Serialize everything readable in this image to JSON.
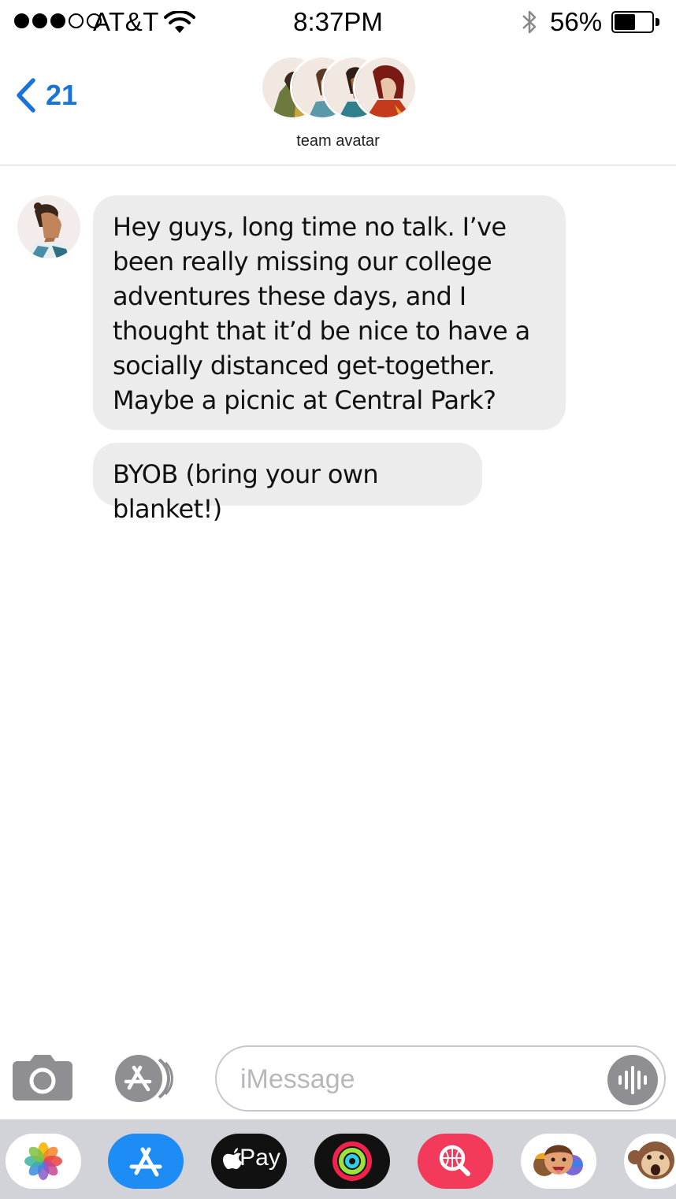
{
  "status_bar": {
    "carrier": "AT&T",
    "time": "8:37PM",
    "battery_percent": "56%",
    "battery_level": 0.56,
    "signal_bars_filled": 3,
    "signal_bars_total": 5
  },
  "header": {
    "back_count": "21",
    "group_name": "team avatar"
  },
  "messages": [
    {
      "text": "Hey guys, long time no talk. I’ve been really missing our college adventures these days, and I thought that it’d be nice to have a socially distanced get-together. Maybe a picnic at Central Park?"
    },
    {
      "text": "BYOB (bring your own blanket!)"
    }
  ],
  "composer": {
    "placeholder": "iMessage"
  },
  "app_drawer": {
    "apple_pay_label": "Pay",
    "apps": [
      "photos-icon",
      "app-store-icon",
      "apple-pay-icon",
      "activity-icon",
      "image-search-icon",
      "memoji-icon",
      "animoji-icon"
    ]
  },
  "colors": {
    "accent_blue": "#1a73d6",
    "bubble_gray": "#ececec",
    "drawer_gray": "#d2d3d8"
  }
}
